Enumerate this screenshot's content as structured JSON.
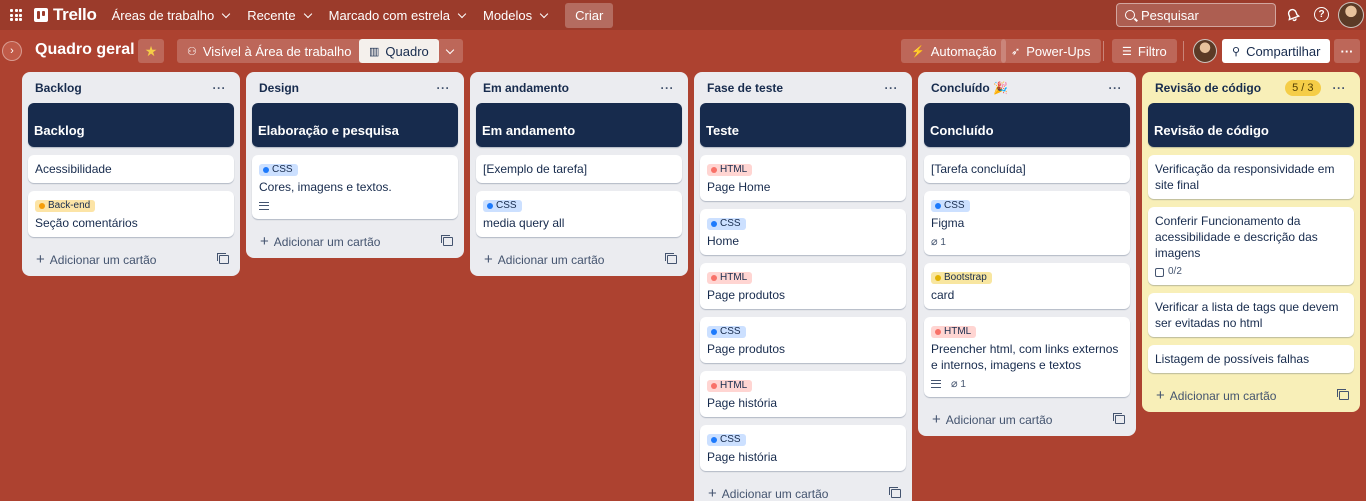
{
  "topbar": {
    "logo": "Trello",
    "menus": [
      "Áreas de trabalho",
      "Recente",
      "Marcado com estrela",
      "Modelos"
    ],
    "create": "Criar",
    "search_placeholder": "Pesquisar"
  },
  "board": {
    "title": "Quadro geral",
    "visibility": "Visível à Área de trabalho",
    "view": "Quadro",
    "automation": "Automação",
    "powerups": "Power-Ups",
    "filter": "Filtro",
    "share": "Compartilhar",
    "more": "···"
  },
  "lists": [
    {
      "title": "Backlog",
      "cover": "Backlog",
      "cards": [
        {
          "text": "Acessibilidade"
        },
        {
          "label": "Back-end",
          "label_type": "back",
          "text": "Seção comentários"
        }
      ],
      "add": "Adicionar um cartão"
    },
    {
      "title": "Design",
      "cover": "Elaboração e pesquisa",
      "cards": [
        {
          "label": "CSS",
          "label_type": "css",
          "text": "Cores, imagens e textos.",
          "has_description": true
        }
      ],
      "add": "Adicionar um cartão"
    },
    {
      "title": "Em andamento",
      "cover": "Em andamento",
      "cards": [
        {
          "text": "[Exemplo de tarefa]"
        },
        {
          "label": "CSS",
          "label_type": "css",
          "text": "media query all"
        }
      ],
      "add": "Adicionar um cartão"
    },
    {
      "title": "Fase de teste",
      "cover": "Teste",
      "cards": [
        {
          "label": "HTML",
          "label_type": "html",
          "text": "Page Home"
        },
        {
          "label": "CSS",
          "label_type": "css",
          "text": "Home"
        },
        {
          "label": "HTML",
          "label_type": "html",
          "text": "Page produtos"
        },
        {
          "label": "CSS",
          "label_type": "css",
          "text": "Page produtos"
        },
        {
          "label": "HTML",
          "label_type": "html",
          "text": "Page história"
        },
        {
          "label": "CSS",
          "label_type": "css",
          "text": "Page história"
        }
      ],
      "add": "Adicionar um cartão"
    },
    {
      "title": "Concluído 🎉",
      "cover": "Concluído",
      "cards": [
        {
          "text": "[Tarefa concluída]"
        },
        {
          "label": "CSS",
          "label_type": "css",
          "text": "Figma",
          "attachments": "1"
        },
        {
          "label": "Bootstrap",
          "label_type": "boot",
          "text": "card"
        },
        {
          "label": "HTML",
          "label_type": "html",
          "text": "Preencher html, com links externos e internos, imagens e textos",
          "has_description": true,
          "attachments": "1"
        }
      ],
      "add": "Adicionar um cartão"
    },
    {
      "title": "Revisão de código",
      "limit": "5 / 3",
      "cover": "Revisão de código",
      "cards": [
        {
          "text": "Verificação da responsividade em site final"
        },
        {
          "text": "Conferir Funcionamento da acessibilidade e descrição das imagens",
          "checklist": "0/2"
        },
        {
          "text": "Verificar a lista de tags que devem ser evitadas no html"
        },
        {
          "text": "Listagem de possíveis falhas"
        }
      ],
      "add": "Adicionar um cartão"
    }
  ]
}
